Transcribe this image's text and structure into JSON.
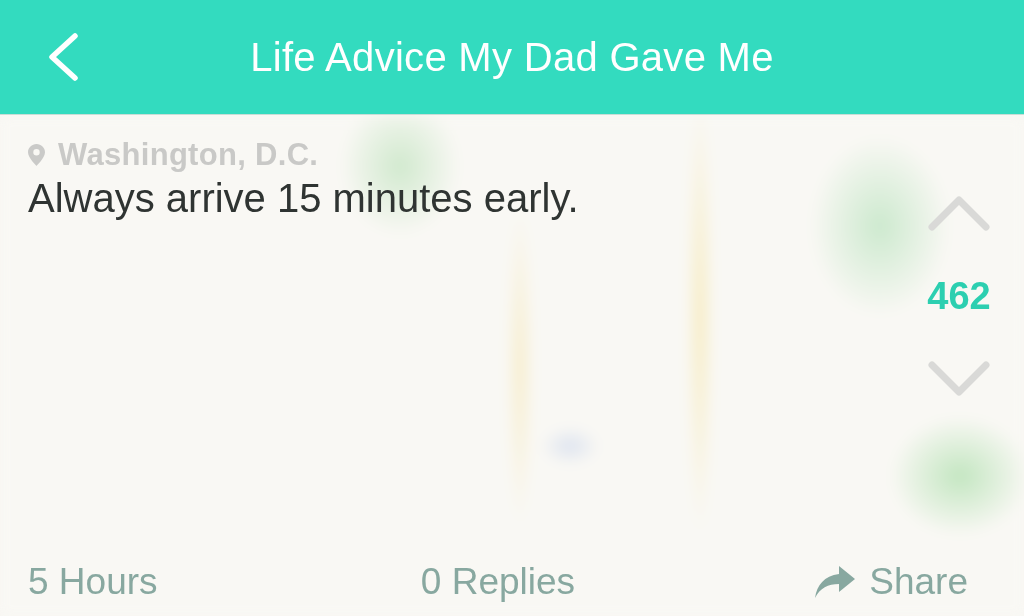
{
  "header": {
    "title": "Life Advice My Dad Gave Me"
  },
  "post": {
    "location": "Washington, D.C.",
    "text": "Always arrive 15 minutes early.",
    "votes": "462"
  },
  "footer": {
    "time": "5 Hours",
    "replies": "0 Replies",
    "share": "Share"
  }
}
